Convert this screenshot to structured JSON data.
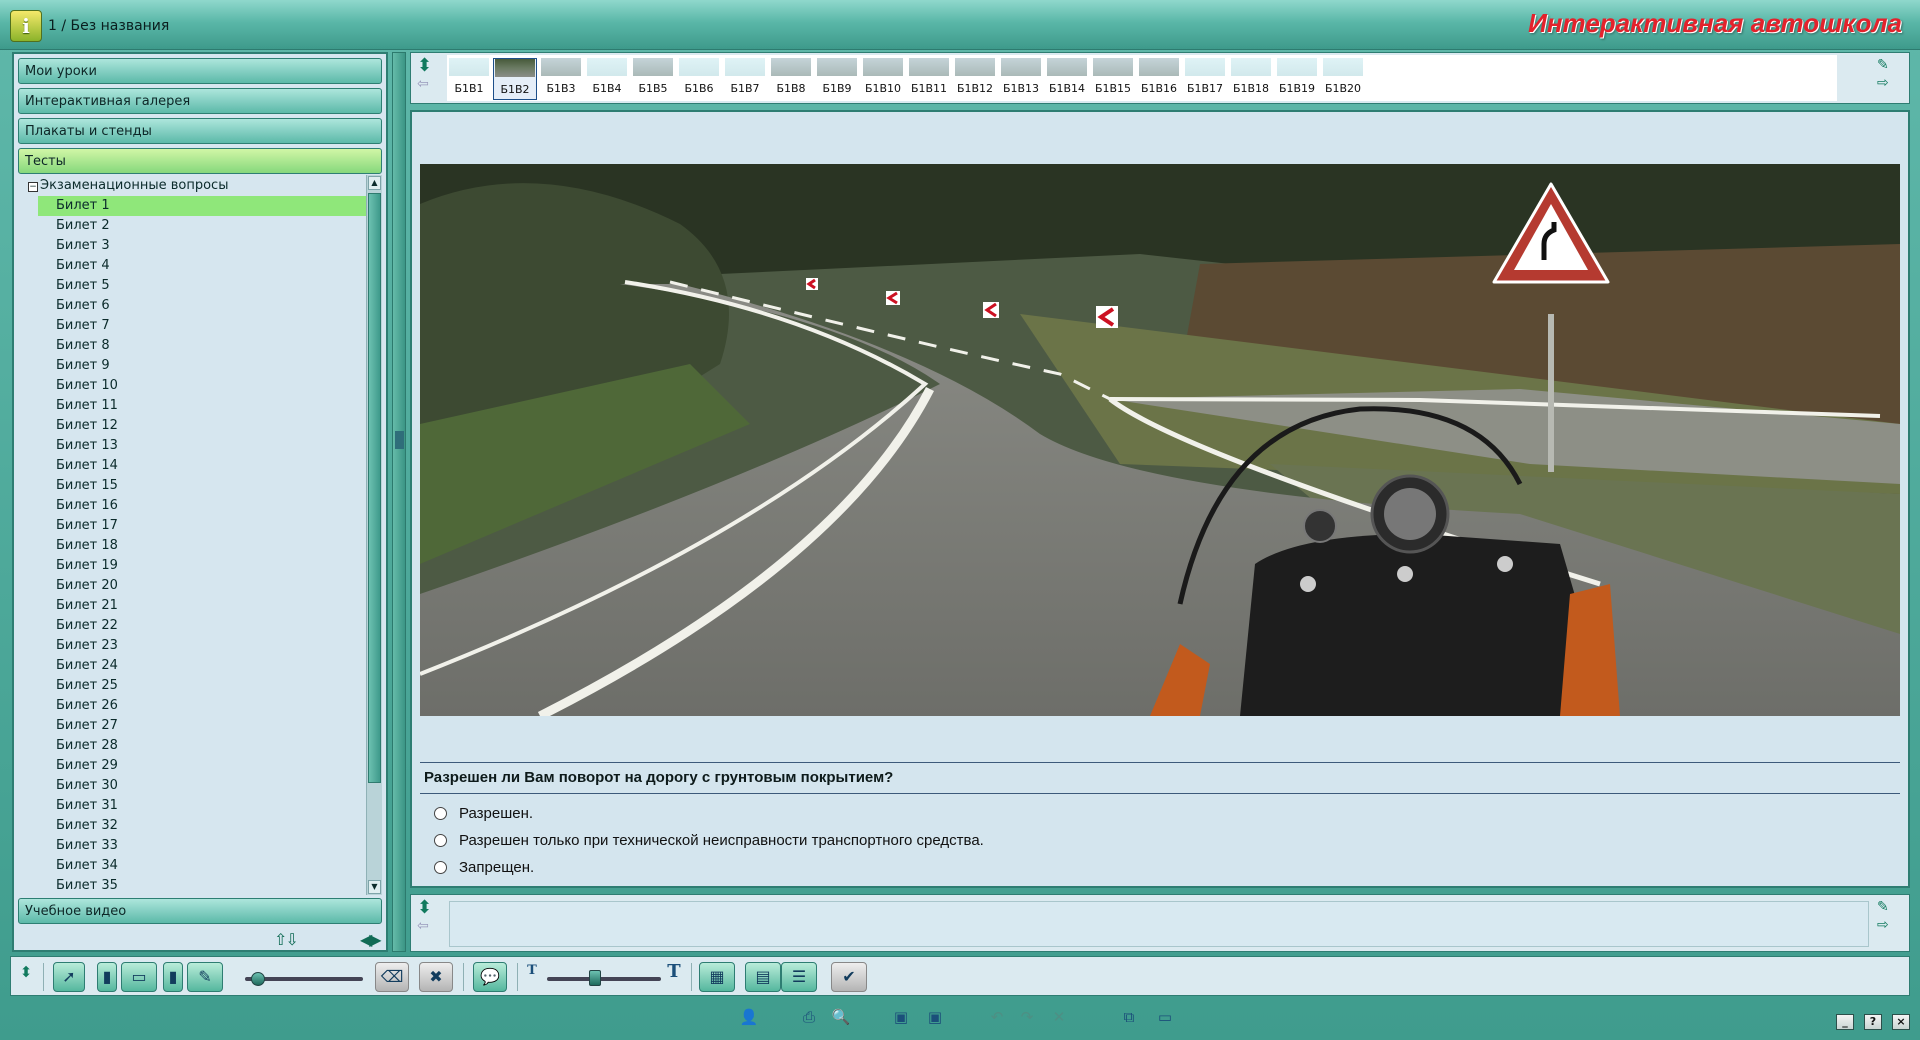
{
  "app": {
    "doc_title": "1 / Без названия",
    "brand": "Интерактивная автошкола"
  },
  "sidebar": {
    "sections": [
      {
        "label": "Мои уроки"
      },
      {
        "label": "Интерактивная галерея"
      },
      {
        "label": "Плакаты и стенды"
      },
      {
        "label": "Тесты"
      }
    ],
    "bottom_section": "Учебное видео",
    "tree_root": "Экзаменационные вопросы",
    "tickets": [
      "Билет 1",
      "Билет 2",
      "Билет 3",
      "Билет 4",
      "Билет 5",
      "Билет 6",
      "Билет 7",
      "Билет 8",
      "Билет 9",
      "Билет 10",
      "Билет 11",
      "Билет 12",
      "Билет 13",
      "Билет 14",
      "Билет 15",
      "Билет 16",
      "Билет 17",
      "Билет 18",
      "Билет 19",
      "Билет 20",
      "Билет 21",
      "Билет 22",
      "Билет 23",
      "Билет 24",
      "Билет 25",
      "Билет 26",
      "Билет 27",
      "Билет 28",
      "Билет 29",
      "Билет 30",
      "Билет 31",
      "Билет 32",
      "Билет 33",
      "Билет 34",
      "Билет 35"
    ],
    "selected_ticket": "Билет 1"
  },
  "thumbnails": {
    "items": [
      "Б1В1",
      "Б1В2",
      "Б1В3",
      "Б1В4",
      "Б1В5",
      "Б1В6",
      "Б1В7",
      "Б1В8",
      "Б1В9",
      "Б1В10",
      "Б1В11",
      "Б1В12",
      "Б1В13",
      "Б1В14",
      "Б1В15",
      "Б1В16",
      "Б1В17",
      "Б1В18",
      "Б1В19",
      "Б1В20"
    ],
    "selected": "Б1В2"
  },
  "question": {
    "text": "Разрешен ли Вам поворот на дорогу с грунтовым покрытием?",
    "answers": [
      "Разрешен.",
      "Разрешен только при технической неисправности транспортного средства.",
      "Запрещен."
    ]
  },
  "colors": {
    "accent": "#3f9c8d",
    "selection": "#8fe77a",
    "brand": "#e3222c"
  }
}
